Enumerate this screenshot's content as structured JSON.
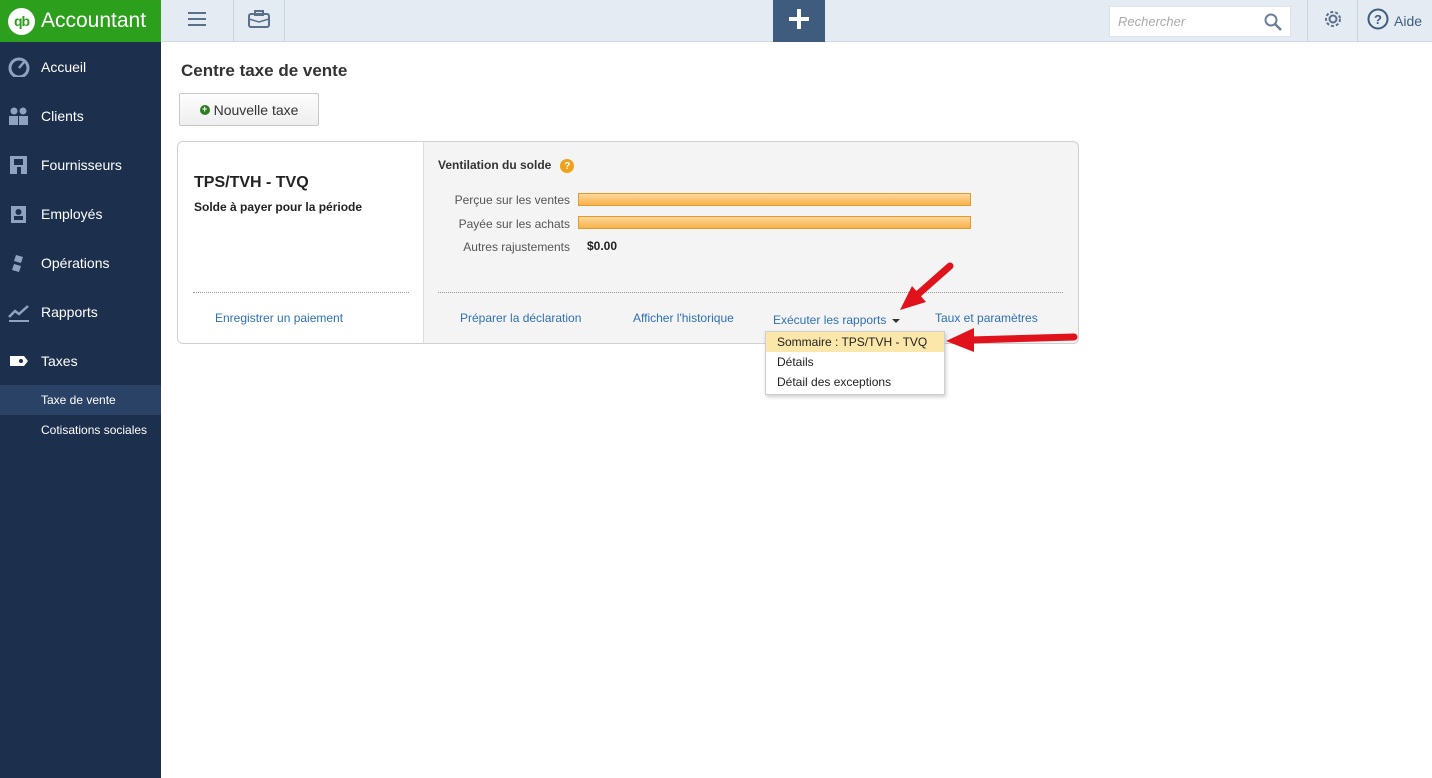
{
  "app": {
    "logo_badge": "qb",
    "logo_text": "Accountant"
  },
  "sidebar": {
    "items": [
      {
        "label": "Accueil",
        "icon": "dashboard-icon"
      },
      {
        "label": "Clients",
        "icon": "customers-icon"
      },
      {
        "label": "Fournisseurs",
        "icon": "vendors-icon"
      },
      {
        "label": "Employés",
        "icon": "employees-icon"
      },
      {
        "label": "Opérations",
        "icon": "transactions-icon"
      },
      {
        "label": "Rapports",
        "icon": "reports-icon"
      },
      {
        "label": "Taxes",
        "icon": "taxes-icon"
      }
    ],
    "sub_items": [
      {
        "label": "Taxe de vente",
        "active": true
      },
      {
        "label": "Cotisations sociales",
        "active": false
      }
    ]
  },
  "topbar": {
    "search_placeholder": "Rechercher",
    "help_label": "Aide"
  },
  "page": {
    "title": "Centre taxe de vente",
    "new_tax_label": "Nouvelle taxe"
  },
  "card": {
    "tax_name": "TPS/TVH - TVQ",
    "subtitle": "Solde à payer pour la période",
    "pay_link": "Enregistrer un paiement",
    "breakdown_title": "Ventilation du solde",
    "help_icon_text": "?",
    "rows": [
      {
        "label": "Perçue sur les ventes"
      },
      {
        "label": "Payée sur les achats"
      },
      {
        "label": "Autres rajustements",
        "amount": "$0.00"
      }
    ],
    "actions": {
      "prepare": "Préparer la déclaration",
      "history": "Afficher l'historique",
      "reports": "Exécuter les rapports",
      "rates": "Taux et paramètres"
    }
  },
  "dropdown": {
    "items": [
      "Sommaire : TPS/TVH - TVQ",
      "Détails",
      "Détail des exceptions"
    ],
    "highlighted_index": 0
  },
  "colors": {
    "sidebar_bg": "#1c2f4c",
    "logo_green": "#2ca01c",
    "link_blue": "#2f6fb8",
    "bar_orange": "#f6b24a",
    "annotation_red": "#e0121b"
  }
}
